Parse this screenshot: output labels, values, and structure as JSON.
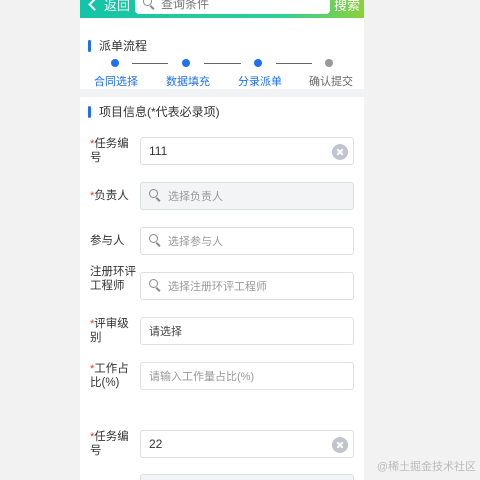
{
  "header": {
    "back_label": "返回",
    "search_placeholder": "查询条件",
    "search_label": "搜索"
  },
  "dispatch": {
    "title": "派单流程",
    "steps": [
      {
        "label": "合同选择",
        "active": true
      },
      {
        "label": "数据填充",
        "active": true
      },
      {
        "label": "分录派单",
        "active": true
      },
      {
        "label": "确认提交",
        "active": false
      }
    ]
  },
  "project": {
    "title": "项目信息(*代表必录项)",
    "fields": [
      {
        "label": "任务编号",
        "required": true,
        "value": "111",
        "type": "input-clearable"
      },
      {
        "label": "负责人",
        "required": true,
        "placeholder": "选择负责人",
        "type": "select-disabled"
      },
      {
        "label": "参与人",
        "required": false,
        "placeholder": "选择参与人",
        "type": "select"
      },
      {
        "label": "注册环评工程师",
        "required": false,
        "placeholder": "选择注册环评工程师",
        "type": "select"
      },
      {
        "label": "评审级别",
        "required": true,
        "placeholder": "请选择",
        "type": "dropdown"
      },
      {
        "label": "工作占比(%)",
        "required": true,
        "placeholder": "请输入工作量占比(%)",
        "type": "input"
      },
      {
        "label": "任务编号",
        "required": true,
        "value": "22",
        "type": "input-clearable"
      }
    ]
  },
  "watermark": "@稀土掘金技术社区",
  "colors": {
    "accent": "#1e6ff1",
    "header_start": "#13c4a8",
    "header_end": "#8bd13a",
    "required": "#e33333"
  }
}
